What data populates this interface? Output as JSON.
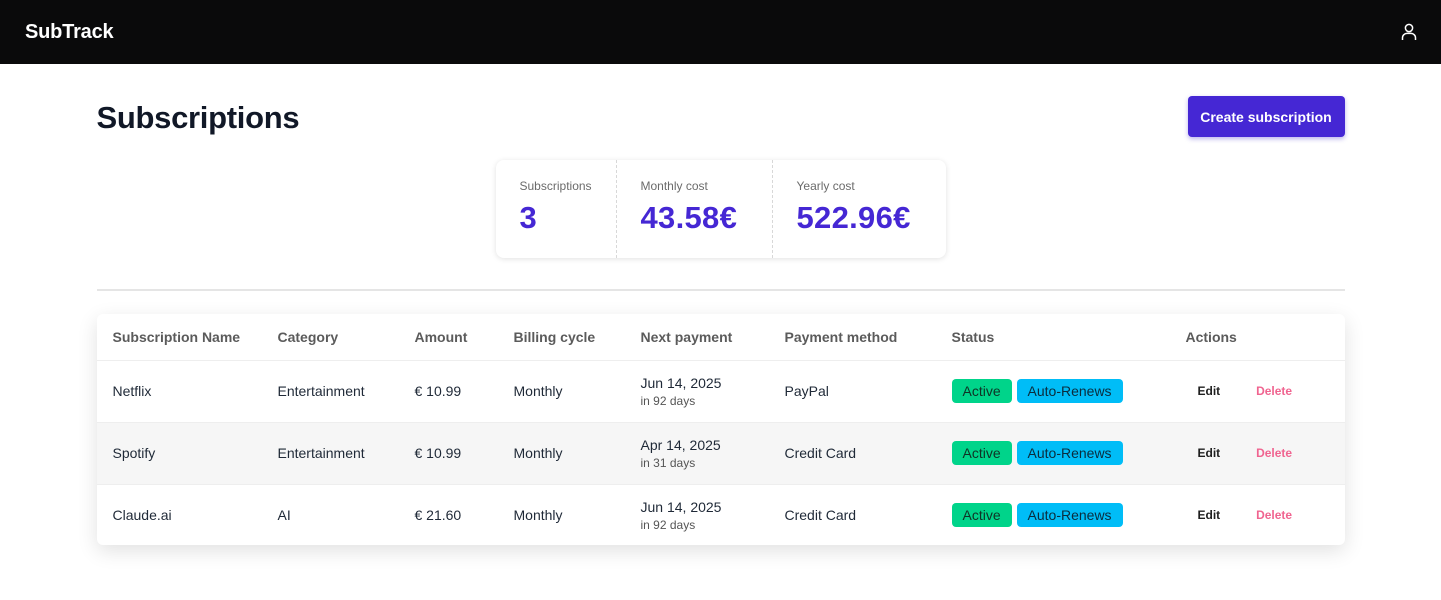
{
  "navbar": {
    "brand": "SubTrack",
    "user_icon": "user-icon"
  },
  "page": {
    "title": "Subscriptions",
    "create_label": "Create subscription"
  },
  "stats": [
    {
      "label": "Subscriptions",
      "value": "3"
    },
    {
      "label": "Monthly cost",
      "value": "43.58€"
    },
    {
      "label": "Yearly cost",
      "value": "522.96€"
    }
  ],
  "table": {
    "headers": [
      "Subscription Name",
      "Category",
      "Amount",
      "Billing cycle",
      "Next payment",
      "Payment method",
      "Status",
      "Actions"
    ],
    "rows": [
      {
        "name": "Netflix",
        "category": "Entertainment",
        "amount": "€ 10.99",
        "cycle": "Monthly",
        "next_date": "Jun 14, 2025",
        "next_rel": "in 92 days",
        "method": "PayPal",
        "status": "Active",
        "renew": "Auto-Renews",
        "edit": "Edit",
        "delete": "Delete"
      },
      {
        "name": "Spotify",
        "category": "Entertainment",
        "amount": "€ 10.99",
        "cycle": "Monthly",
        "next_date": "Apr 14, 2025",
        "next_rel": "in 31 days",
        "method": "Credit Card",
        "status": "Active",
        "renew": "Auto-Renews",
        "edit": "Edit",
        "delete": "Delete"
      },
      {
        "name": "Claude.ai",
        "category": "AI",
        "amount": "€ 21.60",
        "cycle": "Monthly",
        "next_date": "Jun 14, 2025",
        "next_rel": "in 92 days",
        "method": "Credit Card",
        "status": "Active",
        "renew": "Auto-Renews",
        "edit": "Edit",
        "delete": "Delete"
      }
    ]
  },
  "colors": {
    "accent": "#4527d4",
    "active": "#00d48a",
    "renew": "#00bdf7",
    "delete": "#f06490",
    "navbar": "#0a0a0b"
  }
}
